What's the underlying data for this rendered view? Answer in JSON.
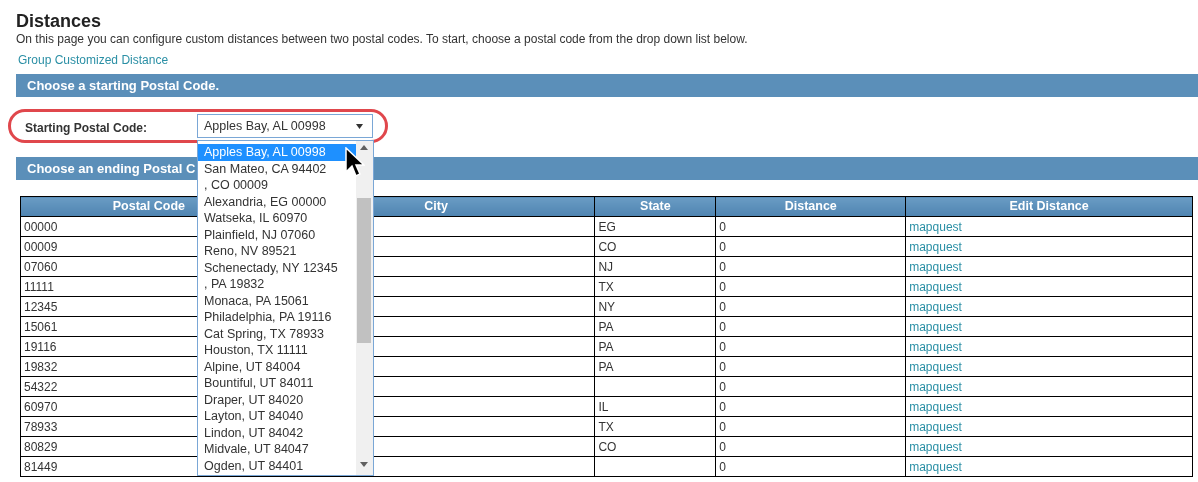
{
  "page": {
    "title": "Distances",
    "description": "On this page you can configure custom distances between two postal codes. To start, choose a postal code from the drop down list below.",
    "link": "Group Customized Distance"
  },
  "start_section": {
    "header": "Choose a starting Postal Code.",
    "label": "Starting Postal Code:",
    "select": {
      "value": "Apples Bay, AL 00998",
      "expanded": true,
      "options": [
        {
          "label": "Apples Bay, AL 00998",
          "selected": true
        },
        {
          "label": "San Mateo, CA 94402",
          "selected": false
        },
        {
          "label": ", CO 00009",
          "selected": false
        },
        {
          "label": "Alexandria, EG 00000",
          "selected": false
        },
        {
          "label": "Watseka, IL 60970",
          "selected": false
        },
        {
          "label": "Plainfield, NJ 07060",
          "selected": false
        },
        {
          "label": "Reno, NV 89521",
          "selected": false
        },
        {
          "label": "Schenectady, NY 12345",
          "selected": false
        },
        {
          "label": ", PA 19832",
          "selected": false
        },
        {
          "label": "Monaca, PA 15061",
          "selected": false
        },
        {
          "label": "Philadelphia, PA 19116",
          "selected": false
        },
        {
          "label": "Cat Spring, TX 78933",
          "selected": false
        },
        {
          "label": "Houston, TX 11111",
          "selected": false
        },
        {
          "label": "Alpine, UT 84004",
          "selected": false
        },
        {
          "label": "Bountiful, UT 84011",
          "selected": false
        },
        {
          "label": "Draper, UT 84020",
          "selected": false
        },
        {
          "label": "Layton, UT 84040",
          "selected": false
        },
        {
          "label": "Lindon, UT 84042",
          "selected": false
        },
        {
          "label": "Midvale, UT 84047",
          "selected": false
        },
        {
          "label": "Ogden, UT 84401",
          "selected": false
        }
      ]
    }
  },
  "end_section": {
    "header": "Choose an ending Postal C",
    "table": {
      "columns": [
        "Postal Code",
        "City",
        "State",
        "Distance",
        "Edit Distance"
      ],
      "rows": [
        {
          "postal_code": "00000",
          "state": "EG",
          "distance": "0",
          "edit": "mapquest"
        },
        {
          "postal_code": "00009",
          "state": "CO",
          "distance": "0",
          "edit": "mapquest"
        },
        {
          "postal_code": "07060",
          "state": "NJ",
          "distance": "0",
          "edit": "mapquest"
        },
        {
          "postal_code": "11111",
          "state": "TX",
          "distance": "0",
          "edit": "mapquest"
        },
        {
          "postal_code": "12345",
          "state": "NY",
          "distance": "0",
          "edit": "mapquest"
        },
        {
          "postal_code": "15061",
          "state": "PA",
          "distance": "0",
          "edit": "mapquest"
        },
        {
          "postal_code": "19116",
          "state": "PA",
          "distance": "0",
          "edit": "mapquest"
        },
        {
          "postal_code": "19832",
          "state": "PA",
          "distance": "0",
          "edit": "mapquest"
        },
        {
          "postal_code": "54322",
          "distance": "0",
          "edit": "mapquest"
        },
        {
          "postal_code": "60970",
          "state": "IL",
          "distance": "0",
          "edit": "mapquest"
        },
        {
          "postal_code": "78933",
          "state": "TX",
          "distance": "0",
          "edit": "mapquest"
        },
        {
          "postal_code": "80829",
          "state": "CO",
          "distance": "0",
          "edit": "mapquest"
        },
        {
          "postal_code": "81449",
          "distance": "0",
          "edit": "mapquest"
        }
      ]
    }
  }
}
